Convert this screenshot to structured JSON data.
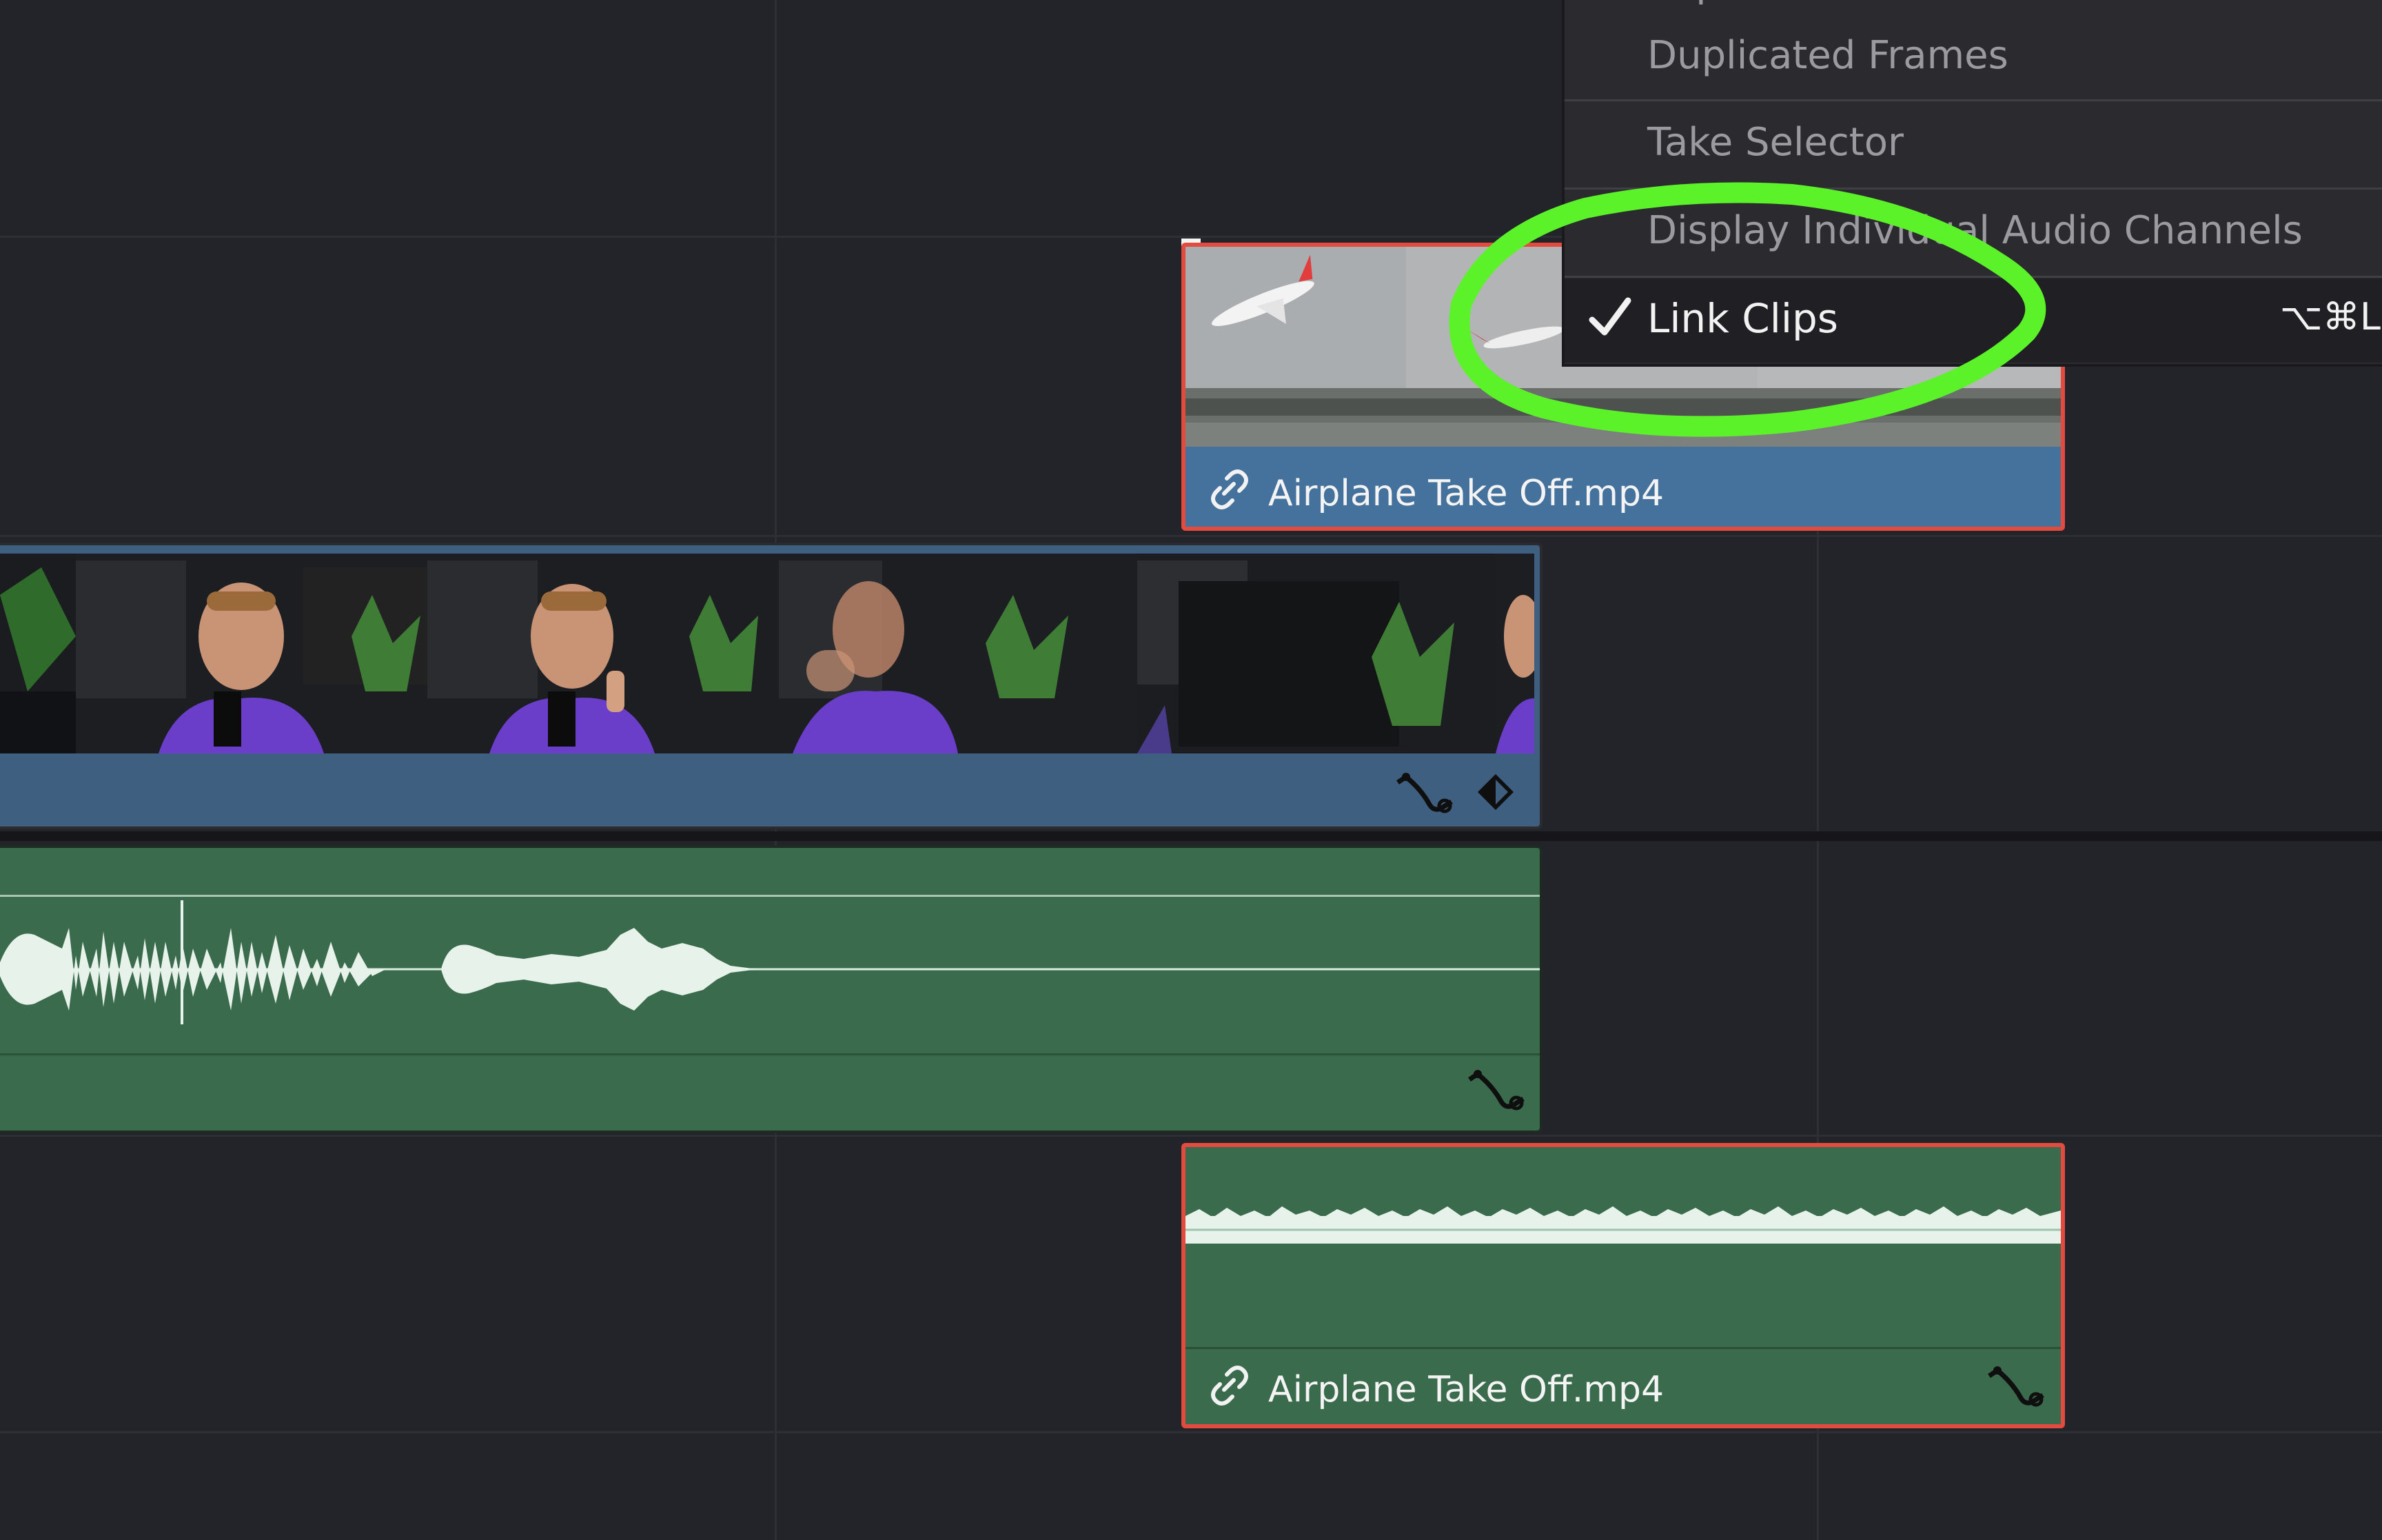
{
  "menu": {
    "items": [
      {
        "label": "Clip Attributes..."
      },
      {
        "label": "Duplicated Frames"
      },
      {
        "label": "Take Selector"
      },
      {
        "label": "Display Individual Audio Channels"
      }
    ],
    "active_item": {
      "label": "Link Clips",
      "shortcut": "⌥⌘L",
      "checked": true
    }
  },
  "clips": {
    "airplane_video": {
      "label": "Airplane Take Off.mp4",
      "icon": "link-icon"
    },
    "airplane_audio": {
      "label": "Airplane Take Off.mp4",
      "icon": "link-icon"
    },
    "main_video": {
      "icon_curve": "curve-icon",
      "icon_keyframe": "keyframe-icon"
    },
    "main_audio": {
      "icon_curve": "curve-icon"
    }
  },
  "annotation": {
    "color": "#5cf22a"
  },
  "colors": {
    "background": "#23232a",
    "video_clip": "#3e5f80",
    "audio_clip": "#3b6b4d",
    "selected_border": "#e34b3f"
  }
}
